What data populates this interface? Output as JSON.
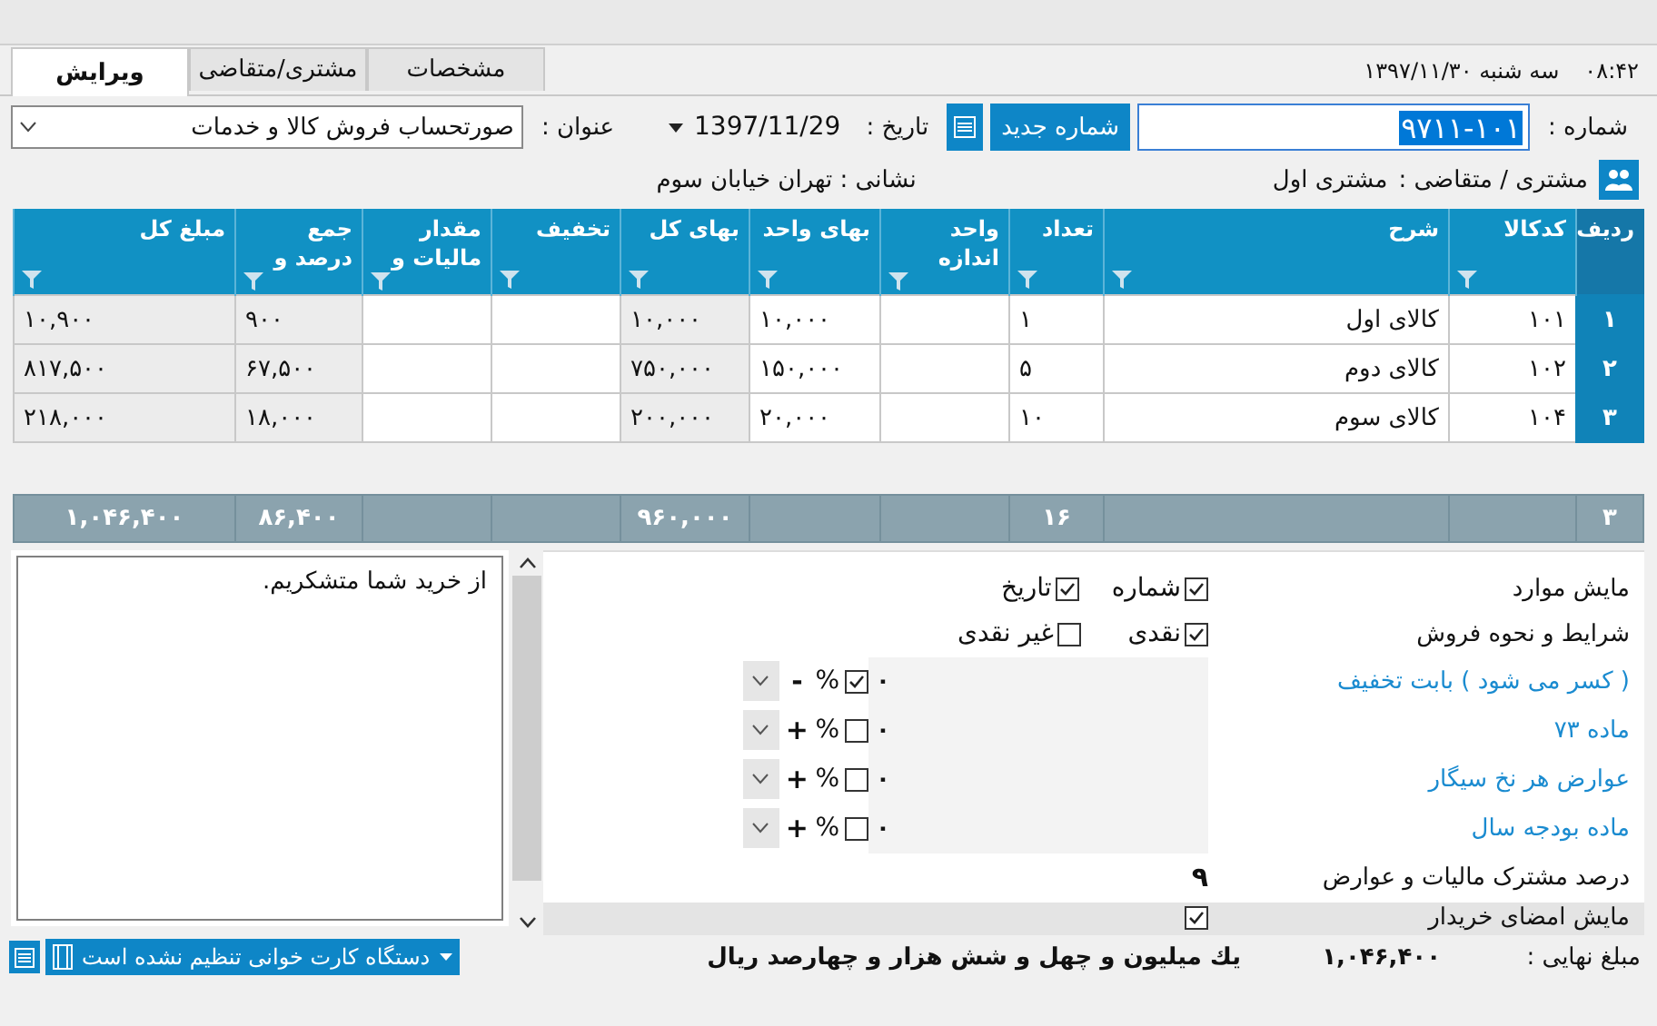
{
  "header": {
    "time": "۰۸:۴۲",
    "date": "سه شنبه ۱۳۹۷/۱۱/۳۰"
  },
  "tabs": [
    {
      "label": "مشخصات",
      "selected": false
    },
    {
      "label": "مشتری/متقاضی",
      "selected": false
    },
    {
      "label": "ویرایش",
      "selected": true
    }
  ],
  "form": {
    "number_label": "شماره :",
    "number_value": "۹۷۱۱-۱۰۱",
    "new_number_button": "شماره جدید",
    "date_label": "تاریخ :",
    "date_value": "1397/11/29",
    "title_label": "عنوان :",
    "title_value": "صورتحساب فروش کالا و خدمات",
    "customer_label": "مشتری / متقاضی :",
    "customer_value": "مشتری اول",
    "address": "نشانی : تهران خیابان سوم"
  },
  "table": {
    "columns": [
      {
        "label": "ردیف",
        "filter": false
      },
      {
        "label": "کدکالا",
        "filter": true,
        "computed": false
      },
      {
        "label": "شرح",
        "filter": true,
        "computed": false
      },
      {
        "label": "تعداد",
        "filter": true,
        "computed": false
      },
      {
        "label": "واحد اندازه",
        "filter": true,
        "computed": false
      },
      {
        "label": "بهای واحد",
        "filter": true,
        "computed": false
      },
      {
        "label": "بهای کل",
        "filter": true,
        "computed": true
      },
      {
        "label": "تخفیف",
        "filter": true,
        "computed": false
      },
      {
        "label": "مقدار مالیات و",
        "filter": true,
        "computed": false
      },
      {
        "label": "جمع درصد و",
        "filter": true,
        "computed": true
      },
      {
        "label": "مبلغ کل",
        "filter": true,
        "computed": true
      }
    ],
    "rows": [
      {
        "row": "۱",
        "code": "۱۰۱",
        "description": "کالای اول",
        "quantity": "۱",
        "unit_price": "۱۰,۰۰۰",
        "total_price": "۱۰,۰۰۰",
        "tax_sum": "۹۰۰",
        "amount": "۱۰,۹۰۰"
      },
      {
        "row": "۲",
        "code": "۱۰۲",
        "description": "کالای دوم",
        "quantity": "۵",
        "unit_price": "۱۵۰,۰۰۰",
        "total_price": "۷۵۰,۰۰۰",
        "tax_sum": "۶۷,۵۰۰",
        "amount": "۸۱۷,۵۰۰"
      },
      {
        "row": "۳",
        "code": "۱۰۴",
        "description": "کالای سوم",
        "quantity": "۱۰",
        "unit_price": "۲۰,۰۰۰",
        "total_price": "۲۰۰,۰۰۰",
        "tax_sum": "۱۸,۰۰۰",
        "amount": "۲۱۸,۰۰۰"
      }
    ],
    "totals": {
      "row": "۳",
      "quantity": "۱۶",
      "total_price": "۹۶۰,۰۰۰",
      "tax_sum": "۸۶,۴۰۰",
      "amount": "۱,۰۴۶,۴۰۰"
    }
  },
  "settings": [
    {
      "kind": "checks",
      "label": "مایش موارد",
      "link": false,
      "options": [
        {
          "label": "شماره",
          "checked": true
        },
        {
          "label": "تاریخ",
          "checked": true
        }
      ]
    },
    {
      "kind": "checks",
      "label": "شرایط و نحوه فروش",
      "link": false,
      "options": [
        {
          "label": "نقدی",
          "checked": true
        },
        {
          "label": "غیر نقدی",
          "checked": false
        }
      ]
    },
    {
      "kind": "rate",
      "label": "( کسر می شود ) بابت تخفیف",
      "link": true,
      "value": "۰",
      "percent": true,
      "percent_label": "%",
      "sign": "-"
    },
    {
      "kind": "rate",
      "label": "ماده ۷۳",
      "link": true,
      "value": "۰",
      "percent": false,
      "percent_label": "%",
      "sign": "+"
    },
    {
      "kind": "rate",
      "label": "عوارض هر نخ سیگار",
      "link": true,
      "value": "۰",
      "percent": false,
      "percent_label": "%",
      "sign": "+"
    },
    {
      "kind": "rate",
      "label": "ماده بودجه سال",
      "link": true,
      "value": "۰",
      "percent": false,
      "percent_label": "%",
      "sign": "+"
    },
    {
      "kind": "number",
      "label": "درصد مشترک مالیات و عوارض",
      "link": false,
      "value": "۹"
    },
    {
      "kind": "check",
      "label": "مایش امضای خریدار",
      "link": false,
      "checked": true
    }
  ],
  "note": "از خرید شما متشکریم.",
  "status_bar": {
    "card_reader": "دستگاه کارت خوانی تنظیم نشده است",
    "amount_words": "یك میلیون و چهل و شش هزار و چهارصد ریال",
    "total": "۱,۰۴۶,۴۰۰",
    "total_label": "مبلغ نهایی :"
  }
}
